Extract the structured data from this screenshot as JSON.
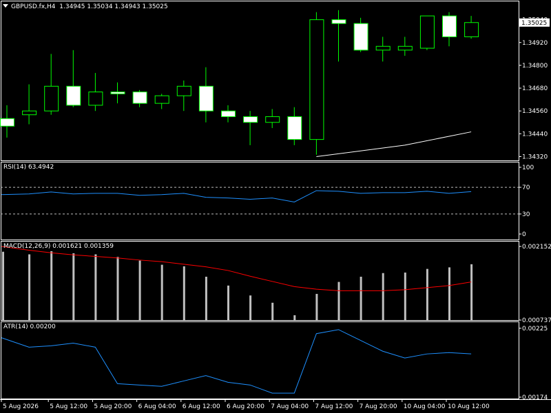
{
  "colors": {
    "background": "#000000",
    "frame": "#ffffff",
    "candle_up_body": "#000000",
    "candle_down_body": "#ffffff",
    "candle_wick": "#00ff00",
    "ma_line": "#ffffff",
    "rsi_line": "#1e90ff",
    "rsi_levels": "#c0c0c0",
    "macd_hist": "#c0c0c0",
    "macd_signal": "#ff0000",
    "atr_line": "#1e90ff",
    "price_tag_bg": "#ffffff",
    "price_tag_text": "#000000"
  },
  "main": {
    "symbol_title": "GBPUSD.fx,H4",
    "ohlc": "1.34945 1.35034 1.34943 1.35025",
    "current_price": "1.35025"
  },
  "rsi_panel": {
    "title": "RSI(14) 63.4942"
  },
  "macd_panel": {
    "title": "MACD(12,26,9) 0.001621 0.001359"
  },
  "atr_panel": {
    "title": "ATR(14) 0.00200"
  },
  "chart_data": [
    {
      "type": "candlestick",
      "name": "price",
      "y_ticks": [
        "1.35040",
        "1.34920",
        "1.34800",
        "1.34680",
        "1.34560",
        "1.34440",
        "1.34320"
      ],
      "ylim": [
        1.343,
        1.3514
      ],
      "candles": [
        {
          "o": 1.3452,
          "h": 1.3459,
          "l": 1.3442,
          "c": 1.3448
        },
        {
          "o": 1.3454,
          "h": 1.347,
          "l": 1.3449,
          "c": 1.3456
        },
        {
          "o": 1.3456,
          "h": 1.3486,
          "l": 1.3454,
          "c": 1.3469
        },
        {
          "o": 1.3469,
          "h": 1.3488,
          "l": 1.3458,
          "c": 1.3459
        },
        {
          "o": 1.3459,
          "h": 1.3476,
          "l": 1.3456,
          "c": 1.3466
        },
        {
          "o": 1.3466,
          "h": 1.3471,
          "l": 1.346,
          "c": 1.3465
        },
        {
          "o": 1.3466,
          "h": 1.3467,
          "l": 1.3458,
          "c": 1.346
        },
        {
          "o": 1.346,
          "h": 1.3465,
          "l": 1.3457,
          "c": 1.3464
        },
        {
          "o": 1.3464,
          "h": 1.3472,
          "l": 1.3456,
          "c": 1.3469
        },
        {
          "o": 1.3469,
          "h": 1.3479,
          "l": 1.345,
          "c": 1.3456
        },
        {
          "o": 1.3456,
          "h": 1.3459,
          "l": 1.345,
          "c": 1.3453
        },
        {
          "o": 1.3453,
          "h": 1.3456,
          "l": 1.3438,
          "c": 1.345
        },
        {
          "o": 1.345,
          "h": 1.3457,
          "l": 1.3447,
          "c": 1.3453
        },
        {
          "o": 1.3453,
          "h": 1.3458,
          "l": 1.3438,
          "c": 1.3441
        },
        {
          "o": 1.3441,
          "h": 1.3508,
          "l": 1.3433,
          "c": 1.3504
        },
        {
          "o": 1.3504,
          "h": 1.3509,
          "l": 1.3482,
          "c": 1.3502
        },
        {
          "o": 1.3502,
          "h": 1.3505,
          "l": 1.3487,
          "c": 1.3488
        },
        {
          "o": 1.3488,
          "h": 1.3495,
          "l": 1.3482,
          "c": 1.349
        },
        {
          "o": 1.3488,
          "h": 1.3495,
          "l": 1.3485,
          "c": 1.349
        },
        {
          "o": 1.3489,
          "h": 1.3506,
          "l": 1.3488,
          "c": 1.3506
        },
        {
          "o": 1.3506,
          "h": 1.3508,
          "l": 1.349,
          "c": 1.3495
        },
        {
          "o": 1.3495,
          "h": 1.3506,
          "l": 1.3494,
          "c": 1.35025
        }
      ],
      "ma": [
        {
          "i": 14,
          "v": 1.3432
        },
        {
          "i": 18,
          "v": 1.3438
        },
        {
          "i": 21,
          "v": 1.3445
        }
      ]
    },
    {
      "type": "line",
      "name": "rsi",
      "levels": [
        70,
        30
      ],
      "y_ticks": [
        "100",
        "70",
        "30",
        "0"
      ],
      "ylim": [
        0,
        100
      ],
      "values": [
        59,
        60,
        63,
        60,
        61,
        61,
        58,
        59,
        61,
        55,
        54,
        52,
        54,
        48,
        65,
        64,
        61,
        62,
        62,
        64,
        61,
        63.49
      ]
    },
    {
      "type": "bar",
      "name": "macd",
      "y_ticks": [
        "0.002152",
        "0.000737"
      ],
      "ylim": [
        0.000737,
        0.002152
      ],
      "values": [
        0.00205,
        0.002,
        0.00206,
        0.00202,
        0.002,
        0.00195,
        0.00188,
        0.0018,
        0.00177,
        0.00157,
        0.0014,
        0.00121,
        0.00107,
        0.00083,
        0.00124,
        0.00147,
        0.00157,
        0.00164,
        0.00165,
        0.00172,
        0.00175,
        0.00181
      ],
      "signal": [
        0.002152,
        0.00208,
        0.00203,
        0.00199,
        0.00196,
        0.00193,
        0.00189,
        0.00186,
        0.00181,
        0.00176,
        0.00169,
        0.00158,
        0.00148,
        0.00138,
        0.00133,
        0.0013,
        0.0013,
        0.0013,
        0.00132,
        0.00136,
        0.0014,
        0.00147
      ]
    },
    {
      "type": "line",
      "name": "atr",
      "y_ticks": [
        "0.00225",
        "0.00174"
      ],
      "ylim": [
        0.00174,
        0.00228
      ],
      "values": [
        0.00218,
        0.00211,
        0.00212,
        0.00214,
        0.00211,
        0.00184,
        0.00183,
        0.00182,
        0.00186,
        0.0019,
        0.00185,
        0.00183,
        0.00177,
        0.00177,
        0.00221,
        0.00224,
        0.00216,
        0.00208,
        0.00203,
        0.00206,
        0.00207,
        0.00206
      ]
    }
  ],
  "x_axis": {
    "labels": [
      {
        "i": 0,
        "text": "5 Aug 2026"
      },
      {
        "i": 2,
        "text": "5 Aug 12:00"
      },
      {
        "i": 4,
        "text": "5 Aug 20:00"
      },
      {
        "i": 6,
        "text": "6 Aug 04:00"
      },
      {
        "i": 8,
        "text": "6 Aug 12:00"
      },
      {
        "i": 10,
        "text": "6 Aug 20:00"
      },
      {
        "i": 12,
        "text": "7 Aug 04:00"
      },
      {
        "i": 14,
        "text": "7 Aug 12:00"
      },
      {
        "i": 16,
        "text": "7 Aug 20:00"
      },
      {
        "i": 18,
        "text": "10 Aug 04:00"
      },
      {
        "i": 20,
        "text": "10 Aug 12:00"
      }
    ]
  }
}
